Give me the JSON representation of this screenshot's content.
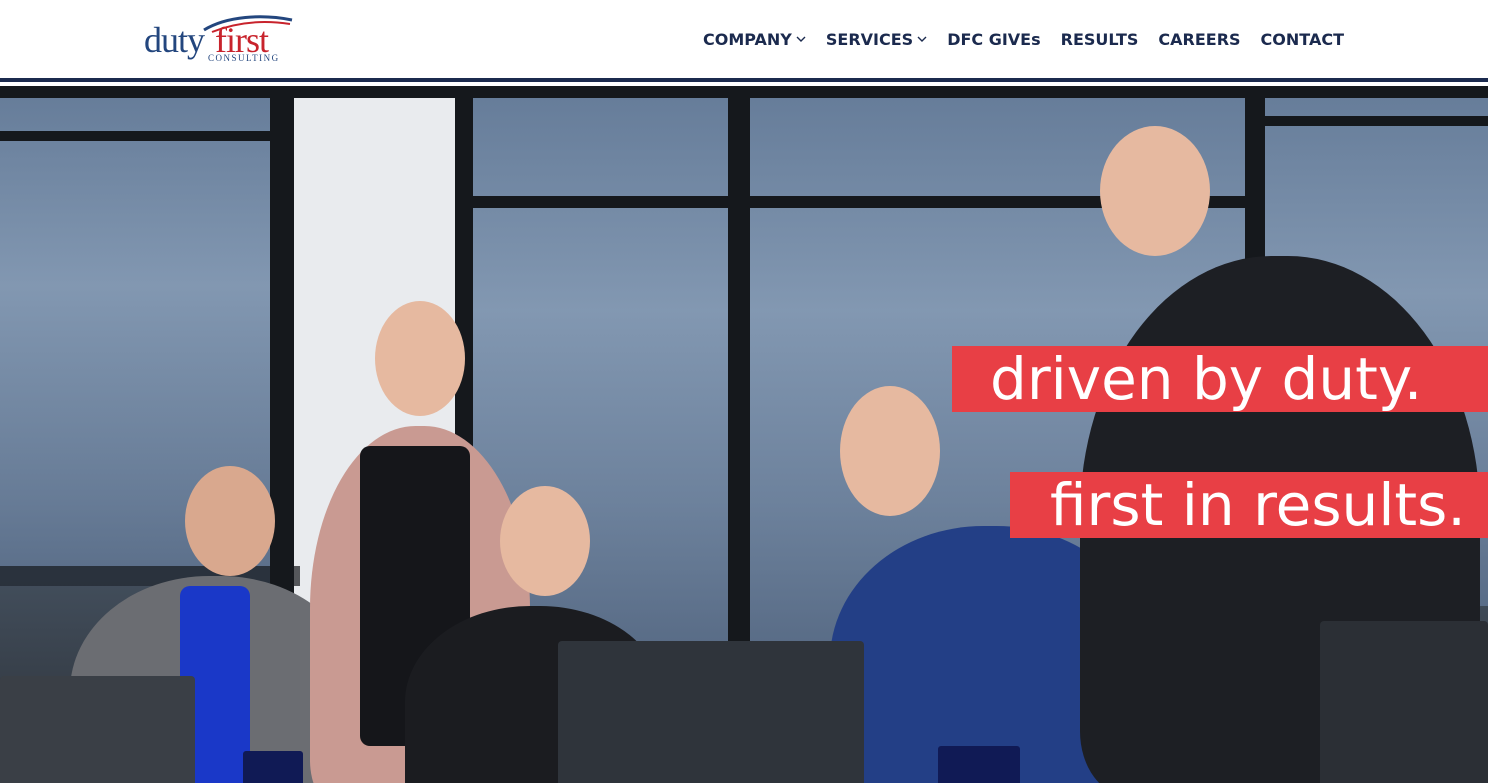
{
  "logo": {
    "word1": "duty",
    "word2": "first",
    "sub": "CONSULTING",
    "colors": {
      "duty": "#23467e",
      "first": "#c8232c"
    }
  },
  "nav": {
    "company": "COMPANY",
    "services": "SERVICES",
    "gives": "DFC GIVEs",
    "results": "RESULTS",
    "careers": "CAREERS",
    "contact": "CONTACT"
  },
  "hero": {
    "tagline1": "driven by duty.",
    "tagline2": "first in results.",
    "accent": "#e83f45"
  },
  "colors": {
    "nav_text": "#1b2a4e",
    "header_border": "#1b2a4e"
  }
}
